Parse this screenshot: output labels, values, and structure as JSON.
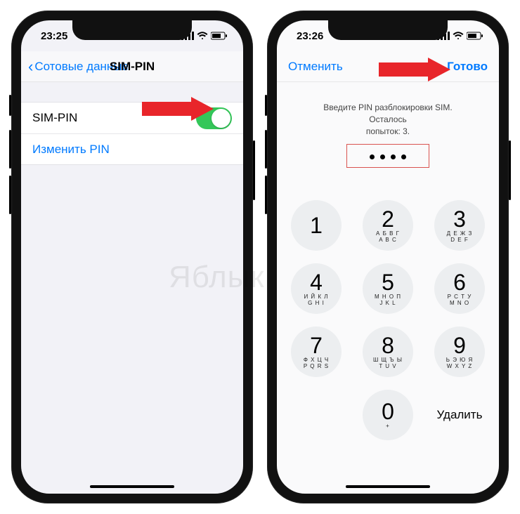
{
  "watermark": "Яблык",
  "left": {
    "time": "23:25",
    "back_label": "Сотовые данные",
    "title": "SIM-PIN",
    "row_sim_pin": "SIM-PIN",
    "row_change_pin": "Изменить PIN"
  },
  "right": {
    "time": "23:26",
    "cancel": "Отменить",
    "done": "Готово",
    "instruction": "Введите PIN разблокировки SIM. Осталось\nпопыток: 3.",
    "delete": "Удалить",
    "keys": [
      {
        "num": "1",
        "let": ""
      },
      {
        "num": "2",
        "let": "А Б В Г\nA B C"
      },
      {
        "num": "3",
        "let": "Д Е Ж З\nD E F"
      },
      {
        "num": "4",
        "let": "И Й К Л\nG H I"
      },
      {
        "num": "5",
        "let": "М Н О П\nJ K L"
      },
      {
        "num": "6",
        "let": "Р С Т У\nM N O"
      },
      {
        "num": "7",
        "let": "Ф Х Ц Ч\nP Q R S"
      },
      {
        "num": "8",
        "let": "Ш Щ Ъ Ы\nT U V"
      },
      {
        "num": "9",
        "let": "Ь Э Ю Я\nW X Y Z"
      },
      {
        "num": "0",
        "let": "+"
      }
    ]
  }
}
